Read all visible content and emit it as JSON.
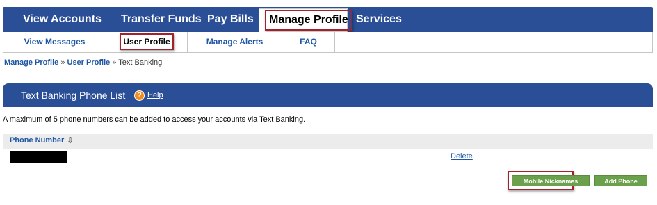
{
  "top_nav": {
    "tabs": [
      {
        "label": "View Accounts"
      },
      {
        "label": "Transfer Funds"
      },
      {
        "label": "Pay Bills"
      },
      {
        "label": "Manage Profile",
        "active": true
      },
      {
        "label": "Services"
      }
    ]
  },
  "sub_nav": {
    "tabs": [
      {
        "label": "View Messages"
      },
      {
        "label": "User Profile",
        "active": true
      },
      {
        "label": "Manage Alerts"
      },
      {
        "label": "FAQ"
      }
    ]
  },
  "breadcrumb": {
    "items": [
      "Manage Profile",
      "User Profile",
      "Text Banking"
    ],
    "separator": "»"
  },
  "panel": {
    "title": "Text Banking Phone List",
    "help_label": "Help",
    "help_icon": "?"
  },
  "info_text": "A maximum of 5 phone numbers can be added to access your accounts via Text Banking.",
  "table": {
    "column_header": "Phone Number",
    "sort_icon": "⇩",
    "rows": [
      {
        "action": "Delete"
      }
    ]
  },
  "buttons": {
    "mobile_nicknames": "Mobile Nicknames",
    "add_phone": "Add Phone"
  },
  "colors": {
    "nav_blue": "#2a4f96",
    "link_blue": "#1f57a4",
    "highlight_red": "#a3212a",
    "button_green": "#6ba04c",
    "help_orange": "#f28c1a"
  }
}
